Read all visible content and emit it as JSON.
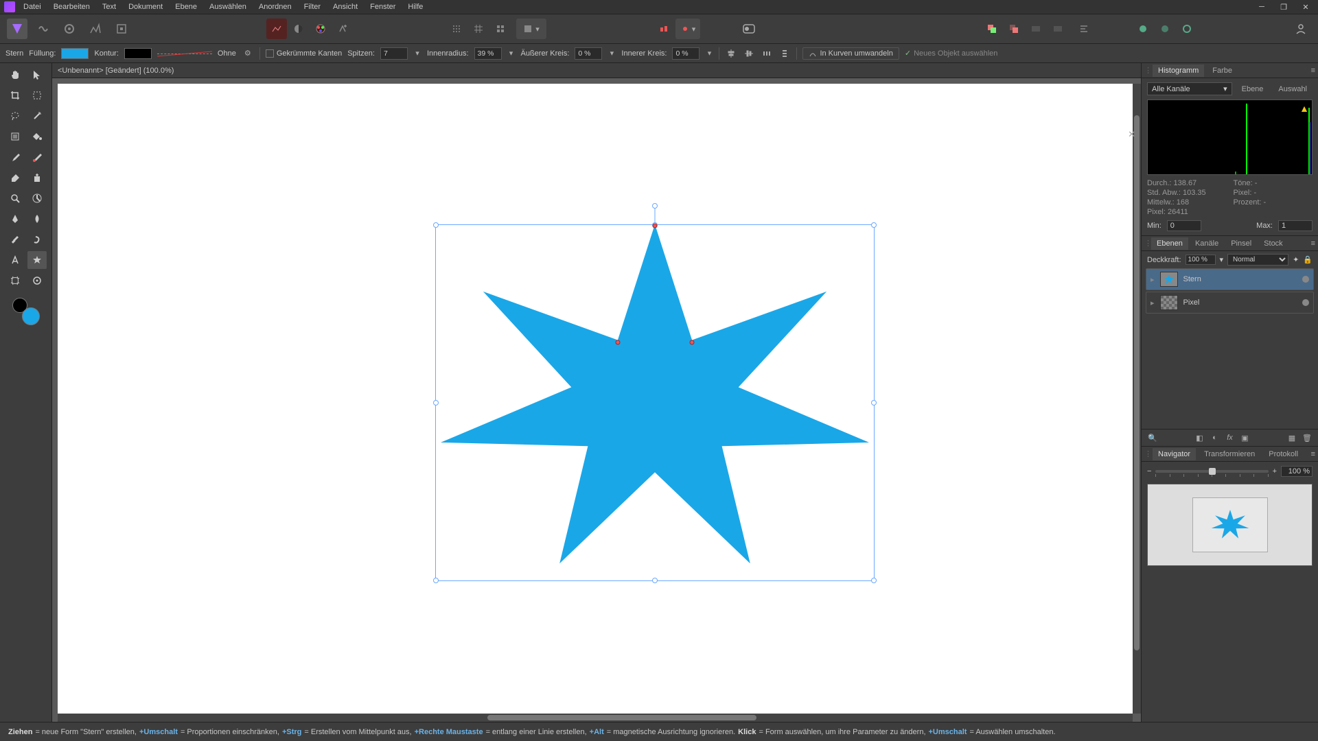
{
  "menu": [
    "Datei",
    "Bearbeiten",
    "Text",
    "Dokument",
    "Ebene",
    "Auswählen",
    "Anordnen",
    "Filter",
    "Ansicht",
    "Fenster",
    "Hilfe"
  ],
  "doc": {
    "tab_label": "<Unbenannt> [Geändert] (100.0%)"
  },
  "ctx": {
    "shape_name": "Stern",
    "fill_label": "Füllung:",
    "stroke_label": "Kontur:",
    "stroke_style_label": "Ohne",
    "curved_edges_label": "Gekrümmte Kanten",
    "points_label": "Spitzen:",
    "points_value": "7",
    "inner_radius_label": "Innenradius:",
    "inner_radius_value": "39 %",
    "outer_circle_label": "Äußerer Kreis:",
    "outer_circle_value": "0 %",
    "inner_circle_label": "Innerer Kreis:",
    "inner_circle_value": "0 %",
    "to_curves_label": "In Kurven umwandeln",
    "new_obj_label": "Neues Objekt auswählen"
  },
  "colors": {
    "fill": "#1aa7e8",
    "stroke": "#000000"
  },
  "right": {
    "hist_tab": "Histogramm",
    "color_tab": "Farbe",
    "channel_select": "Alle Kanäle",
    "ebene_btn": "Ebene",
    "auswahl_btn": "Auswahl",
    "stats": {
      "mean_l": "Durch.:",
      "mean_v": "138.67",
      "std_l": "Std. Abw.:",
      "std_v": "103.35",
      "median_l": "Mittelw.:",
      "median_v": "168",
      "pixel_l": "Pixel:",
      "pixel_v": "26411",
      "tones_l": "Töne:",
      "tones_v": "-",
      "peak_l": "Pixel:",
      "peak_v": "-",
      "perc_l": "Prozent:",
      "perc_v": "-"
    },
    "min_l": "Min:",
    "min_v": "0",
    "max_l": "Max:",
    "max_v": "1",
    "layers_tabs": [
      "Ebenen",
      "Kanäle",
      "Pinsel",
      "Stock"
    ],
    "opacity_l": "Deckkraft:",
    "opacity_v": "100 %",
    "blend_v": "Normal",
    "layers": [
      {
        "name": "Stern",
        "selected": true,
        "thumb": "star"
      },
      {
        "name": "Pixel",
        "selected": false,
        "thumb": "checker"
      }
    ],
    "nav_tabs": [
      "Navigator",
      "Transformieren",
      "Protokoll"
    ],
    "zoom_v": "100 %"
  },
  "status": {
    "s1a": "Ziehen",
    "s1b": " = neue Form \"Stern\" erstellen, ",
    "s2a": "+Umschalt",
    "s2b": " = Proportionen einschränken, ",
    "s3a": "+Strg",
    "s3b": " = Erstellen vom Mittelpunkt aus, ",
    "s4a": "+Rechte Maustaste",
    "s4b": " = entlang einer Linie erstellen, ",
    "s5a": "+Alt",
    "s5b": " = magnetische Ausrichtung ignorieren. ",
    "s6a": "Klick",
    "s6b": " = Form auswählen, um ihre Parameter zu ändern, ",
    "s7a": "+Umschalt",
    "s7b": " = Auswählen umschalten."
  }
}
